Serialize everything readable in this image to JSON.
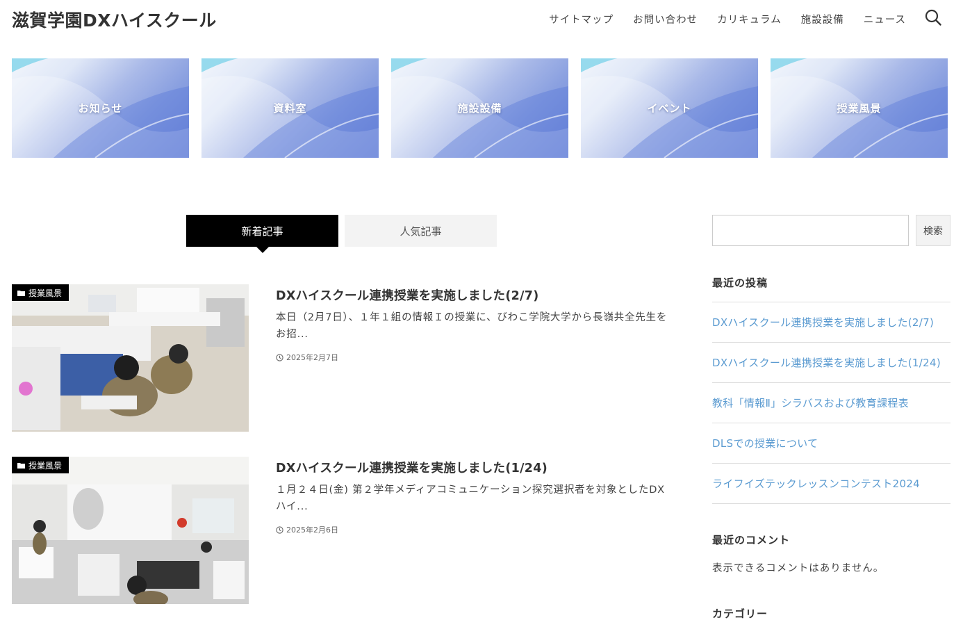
{
  "site": {
    "title": "滋賀学園DXハイスクール"
  },
  "nav": {
    "items": [
      "サイトマップ",
      "お問い合わせ",
      "カリキュラム",
      "施設設備",
      "ニュース"
    ]
  },
  "banners": [
    "お知らせ",
    "資料室",
    "施設設備",
    "イベント",
    "授業風景"
  ],
  "tabs": {
    "new": "新着記事",
    "popular": "人気記事"
  },
  "posts": [
    {
      "category": "授業風景",
      "title": "DXハイスクール連携授業を実施しました(2/7)",
      "excerpt": "本日（2月7日）、１年１組の情報Ｉの授業に、びわこ学院大学から長嶺共全先生をお招...",
      "date": "2025年2月7日"
    },
    {
      "category": "授業風景",
      "title": "DXハイスクール連携授業を実施しました(1/24)",
      "excerpt": "１月２４日(金) 第２学年メディアコミュニケーション探究選択者を対象としたDXハイ...",
      "date": "2025年2月6日"
    }
  ],
  "sidebar": {
    "search_button": "検索",
    "recent_posts_title": "最近の投稿",
    "recent_posts": [
      "DXハイスクール連携授業を実施しました(2/7)",
      "DXハイスクール連携授業を実施しました(1/24)",
      "教科「情報Ⅱ」シラバスおよび教育課程表",
      "DLSでの授業について",
      "ライフイズテックレッスンコンテスト2024"
    ],
    "recent_comments_title": "最近のコメント",
    "no_comments": "表示できるコメントはありません。",
    "categories_title": "カテゴリー"
  },
  "colors": {
    "link": "#5b9bd1",
    "tab_active": "#000000",
    "tab_inactive": "#f3f3f3"
  }
}
